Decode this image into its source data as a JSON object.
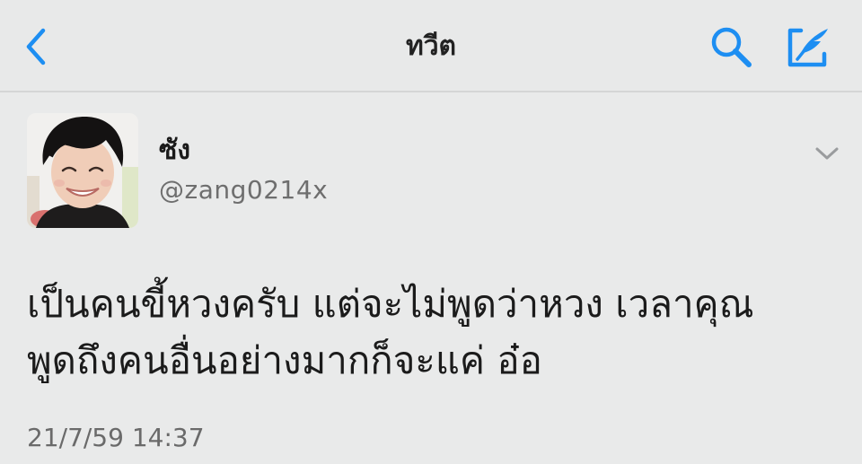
{
  "nav": {
    "title": "ทวีต",
    "back_icon": "chevron-left-icon",
    "search_icon": "search-icon",
    "compose_icon": "compose-tweet-icon",
    "accent_color": "#1d8ef2"
  },
  "tweet": {
    "author": {
      "display_name": "ซัง",
      "handle": "@zang0214x"
    },
    "text_line1": "เป็นคนขี้หวงครับ แต่จะไม่พูดว่าหวง เวลาคุณ",
    "text_line2": "พูดถึงคนอื่นอย่างมากก็จะแค่ อ๋อ",
    "timestamp": "21/7/59 14:37",
    "menu_icon": "chevron-down-icon"
  }
}
